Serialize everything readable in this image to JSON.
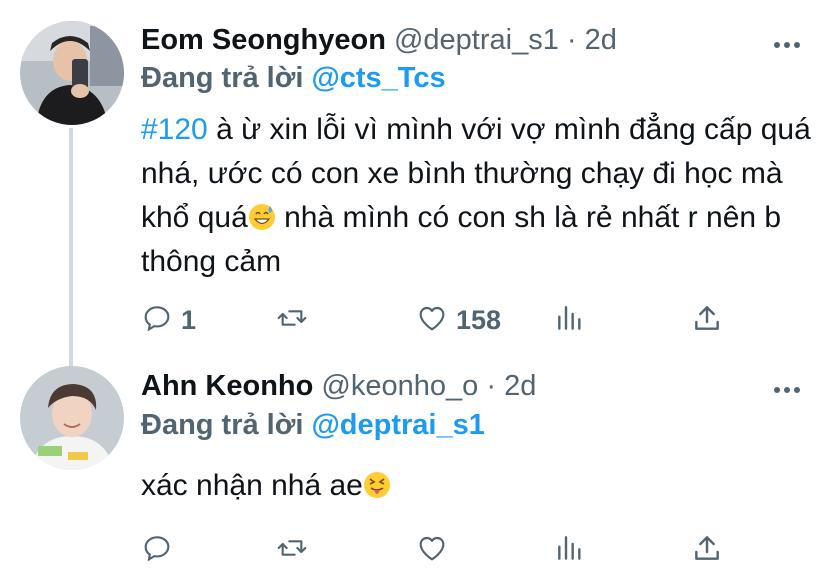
{
  "tweets": [
    {
      "name": "Eom Seonghyeon",
      "handle": "@deptrai_s1",
      "separator": "·",
      "time": "2d",
      "replying_label": "Đang trả lời",
      "replying_to": "@cts_Tcs",
      "hashtag": "#120",
      "text_part1": " à ừ xin lỗi vì mình với vợ mình đẳng cấp quá nhá, ước có con xe bình thường chạy đi học mà khổ quá",
      "text_part2": "  nhà mình có con sh là rẻ nhất r nên b thông cảm",
      "reply_count": "1",
      "retweet_count": "",
      "like_count": "158"
    },
    {
      "name": "Ahn Keonho",
      "handle": "@keonho_o",
      "separator": "·",
      "time": "2d",
      "replying_label": "Đang trả lời",
      "replying_to": "@deptrai_s1",
      "text": "xác nhận nhá ae",
      "reply_count": "",
      "retweet_count": "",
      "like_count": ""
    }
  ],
  "icons": [
    "reply-icon",
    "retweet-icon",
    "like-icon",
    "analytics-icon",
    "share-icon",
    "more-icon"
  ],
  "colors": {
    "link": "#1d9bf0",
    "muted": "#536471",
    "text": "#0f1419",
    "thread_line": "#cfd9de"
  }
}
